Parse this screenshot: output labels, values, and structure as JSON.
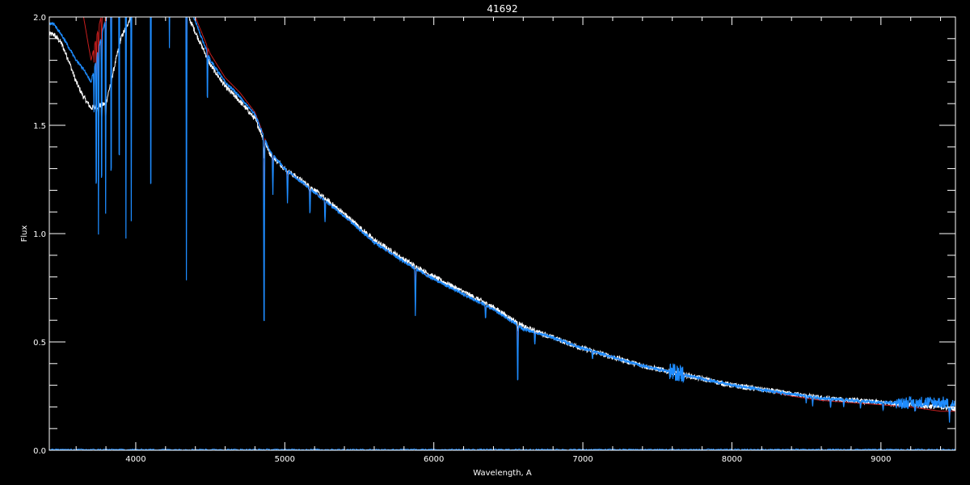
{
  "chart_data": {
    "type": "line",
    "title": "41692",
    "xlabel": "Wavelength, A",
    "ylabel": "Flux",
    "xlim": [
      3420,
      9500
    ],
    "ylim": [
      0.0,
      2.0
    ],
    "xticks_major": [
      4000,
      5000,
      6000,
      7000,
      8000,
      9000
    ],
    "yticks_major": [
      0.0,
      0.5,
      1.0,
      1.5,
      2.0
    ],
    "ytick_labels": [
      "0.0",
      "0.5",
      "1.0",
      "1.5",
      "2.0"
    ],
    "grid": false,
    "colors": {
      "background": "#000000",
      "axes": "#ffffff",
      "observed": "#ffffff",
      "model": "#c81e1e",
      "fit": "#1e8cff"
    },
    "series": [
      {
        "role": "observed",
        "color": "#ffffff",
        "x": [
          3450,
          3500,
          3550,
          3600,
          3650,
          3700,
          3800,
          3900,
          4000,
          4100,
          4200,
          4300,
          4400,
          4500,
          4600,
          4700,
          4800,
          4900,
          5000,
          5200,
          5400,
          5600,
          5800,
          6000,
          6200,
          6400,
          6600,
          6800,
          7000,
          7200,
          7400,
          7600,
          7800,
          8000,
          8200,
          8400,
          8600,
          8800,
          9000,
          9200,
          9400,
          9500
        ],
        "y": [
          1.92,
          1.88,
          1.8,
          1.7,
          1.63,
          1.58,
          1.6,
          1.9,
          2.05,
          2.1,
          2.12,
          2.08,
          1.93,
          1.78,
          1.68,
          1.61,
          1.53,
          1.37,
          1.3,
          1.2,
          1.09,
          0.97,
          0.88,
          0.8,
          0.73,
          0.66,
          0.57,
          0.52,
          0.47,
          0.43,
          0.39,
          0.36,
          0.33,
          0.3,
          0.28,
          0.26,
          0.24,
          0.23,
          0.22,
          0.21,
          0.2,
          0.19
        ]
      },
      {
        "role": "model",
        "color": "#c81e1e",
        "x": [
          3450,
          3500,
          3550,
          3600,
          3650,
          3700,
          3800,
          3900,
          4000,
          4100,
          4200,
          4300,
          4400,
          4500,
          4600,
          4700,
          4800,
          4900,
          5000,
          5200,
          5400,
          5600,
          5800,
          6000,
          6200,
          6400,
          6600,
          6800,
          7000,
          7200,
          7400,
          7600,
          7800,
          8000,
          8200,
          8400,
          8600,
          8800,
          9000,
          9200,
          9400,
          9500
        ],
        "y": [
          2.2,
          2.15,
          2.1,
          2.06,
          2.0,
          1.8,
          2.1,
          2.3,
          2.35,
          2.33,
          2.3,
          2.2,
          2.0,
          1.83,
          1.72,
          1.65,
          1.56,
          1.38,
          1.3,
          1.19,
          1.08,
          0.96,
          0.87,
          0.79,
          0.72,
          0.65,
          0.56,
          0.52,
          0.47,
          0.43,
          0.39,
          0.36,
          0.33,
          0.3,
          0.28,
          0.25,
          0.23,
          0.22,
          0.21,
          0.2,
          0.18,
          0.18
        ]
      },
      {
        "role": "fit",
        "color": "#1e8cff",
        "x": [
          3450,
          3500,
          3550,
          3600,
          3650,
          3700,
          3800,
          3900,
          4000,
          4100,
          4200,
          4300,
          4400,
          4500,
          4600,
          4700,
          4800,
          4900,
          5000,
          5200,
          5400,
          5600,
          5800,
          6000,
          6200,
          6400,
          6600,
          6800,
          7000,
          7200,
          7400,
          7600,
          7800,
          8000,
          8200,
          8400,
          8600,
          8800,
          9000,
          9200,
          9400,
          9500
        ],
        "y": [
          1.97,
          1.92,
          1.86,
          1.8,
          1.76,
          1.7,
          2.0,
          2.2,
          2.28,
          2.25,
          2.22,
          2.15,
          1.98,
          1.8,
          1.7,
          1.63,
          1.55,
          1.38,
          1.3,
          1.19,
          1.08,
          0.96,
          0.87,
          0.79,
          0.72,
          0.65,
          0.56,
          0.52,
          0.47,
          0.43,
          0.39,
          0.36,
          0.33,
          0.3,
          0.28,
          0.26,
          0.24,
          0.23,
          0.22,
          0.22,
          0.22,
          0.21
        ]
      }
    ],
    "absorption_lines": [
      {
        "x": 3720,
        "depth": 0.2
      },
      {
        "x": 3735,
        "depth": 0.7
      },
      {
        "x": 3750,
        "depth": 0.85
      },
      {
        "x": 3771,
        "depth": 0.8
      },
      {
        "x": 3798,
        "depth": 0.9
      },
      {
        "x": 3835,
        "depth": 0.95
      },
      {
        "x": 3889,
        "depth": 1.0
      },
      {
        "x": 3934,
        "depth": 1.25
      },
      {
        "x": 3970,
        "depth": 1.2
      },
      {
        "x": 4101,
        "depth": 1.25
      },
      {
        "x": 4226,
        "depth": 0.35
      },
      {
        "x": 4340,
        "depth": 1.3
      },
      {
        "x": 4481,
        "depth": 0.25
      },
      {
        "x": 4861,
        "depth": 0.95
      },
      {
        "x": 4920,
        "depth": 0.18
      },
      {
        "x": 5018,
        "depth": 0.15
      },
      {
        "x": 5169,
        "depth": 0.12
      },
      {
        "x": 5270,
        "depth": 0.1
      },
      {
        "x": 5876,
        "depth": 0.22
      },
      {
        "x": 6347,
        "depth": 0.06
      },
      {
        "x": 6563,
        "depth": 0.28
      },
      {
        "x": 6678,
        "depth": 0.06
      },
      {
        "x": 7065,
        "depth": 0.04
      },
      {
        "x": 8498,
        "depth": 0.03
      },
      {
        "x": 8542,
        "depth": 0.04
      },
      {
        "x": 8662,
        "depth": 0.04
      },
      {
        "x": 8750,
        "depth": 0.03
      },
      {
        "x": 8863,
        "depth": 0.04
      },
      {
        "x": 9015,
        "depth": 0.04
      },
      {
        "x": 9229,
        "depth": 0.05
      },
      {
        "x": 9460,
        "depth": 0.1
      }
    ],
    "noise_series_near_zero": {
      "color": "#1e8cff",
      "y_level": 0.0
    }
  }
}
